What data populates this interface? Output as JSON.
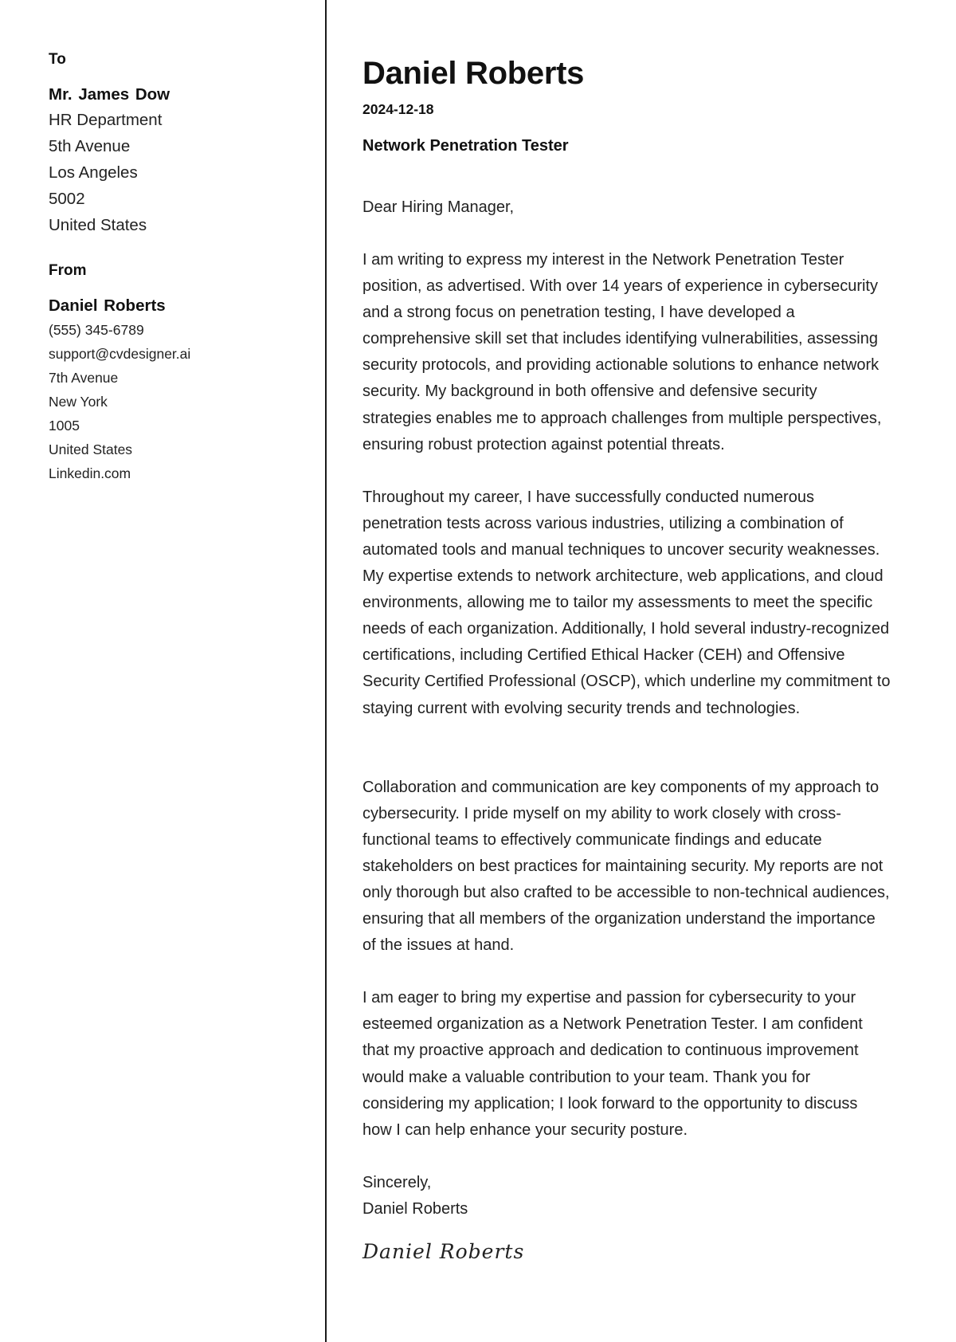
{
  "recipient": {
    "heading": "To",
    "name": "Mr. James Dow",
    "lines": [
      "HR Department",
      "5th Avenue",
      "Los Angeles",
      "5002",
      "United States"
    ]
  },
  "sender": {
    "heading": "From",
    "name": "Daniel Roberts",
    "lines": [
      "(555) 345-6789",
      "support@cvdesigner.ai",
      "7th Avenue",
      "New York",
      "1005",
      "United States",
      "Linkedin.com"
    ]
  },
  "letter": {
    "author_name": "Daniel Roberts",
    "date": "2024-12-18",
    "position": "Network Penetration Tester",
    "salutation": "Dear Hiring Manager,",
    "paragraphs": [
      [
        "I am writing to express my interest in the Network Penetration Tester",
        "position, as advertised. With over 14 years of experience in cybersecurity",
        "and a strong focus on penetration testing, I have developed a",
        "comprehensive skill set that includes identifying vulnerabilities, assessing",
        "security protocols, and providing actionable solutions to enhance network",
        "security. My background in both offensive and defensive security",
        "strategies enables me to approach challenges from multiple perspectives,",
        "ensuring robust protection against potential threats."
      ],
      [
        "Throughout my career, I have successfully conducted numerous",
        "penetration tests across various industries, utilizing a combination of",
        "automated tools and manual techniques to uncover security weaknesses.",
        "My expertise extends to network architecture, web applications, and cloud",
        "environments, allowing me to tailor my assessments to meet the specific",
        "needs of each organization. Additionally, I hold several industry-recognized",
        "certifications, including Certified Ethical Hacker (CEH) and Offensive",
        "Security Certified Professional (OSCP), which underline my commitment to",
        "staying current with evolving security trends and technologies."
      ],
      [
        "Collaboration and communication are key components of my approach to",
        "cybersecurity. I pride myself on my ability to work closely with cross-",
        "functional teams to effectively communicate findings and educate",
        "stakeholders on best practices for maintaining security. My reports are not",
        "only thorough but also crafted to be accessible to non-technical audiences,",
        "ensuring that all members of the organization understand the importance",
        "of the issues at hand."
      ],
      [
        "I am eager to bring my expertise and passion for cybersecurity to your",
        "esteemed organization as a Network Penetration Tester. I am confident",
        "that my proactive approach and dedication to continuous improvement",
        "would make a valuable contribution to your team. Thank you for",
        "considering my application; I look forward to the opportunity to discuss",
        "how I can help enhance your security posture."
      ]
    ],
    "closing": "Sincerely,",
    "closing_name": "Daniel Roberts",
    "signature": "Daniel Roberts"
  }
}
